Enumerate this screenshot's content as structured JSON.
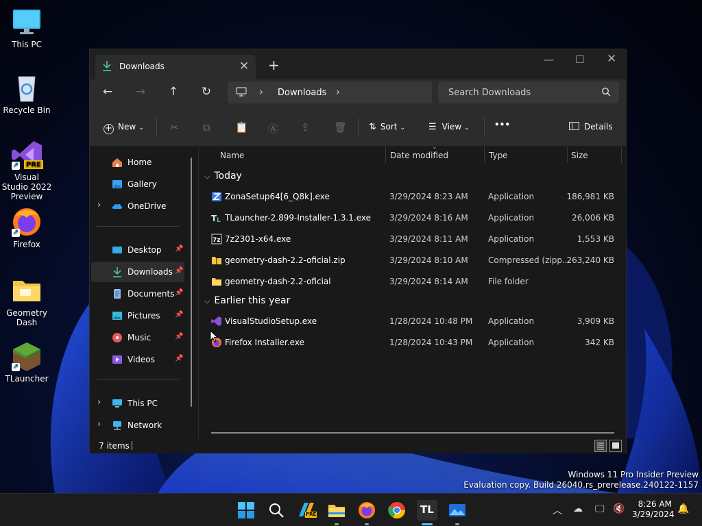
{
  "desktop": {
    "icons": [
      {
        "label": "This PC"
      },
      {
        "label": "Recycle Bin"
      },
      {
        "label": "Visual Studio 2022 Preview",
        "badge": "PRE"
      },
      {
        "label": "Firefox"
      },
      {
        "label": "Geometry Dash"
      },
      {
        "label": "TLauncher"
      }
    ]
  },
  "window": {
    "tab_title": "Downloads",
    "address": {
      "crumb": "Downloads"
    },
    "search": {
      "placeholder": "Search Downloads"
    },
    "commands": {
      "new": "New",
      "sort": "Sort",
      "view": "View",
      "more": "•••",
      "details": "Details"
    },
    "nav": [
      {
        "label": "Home"
      },
      {
        "label": "Gallery"
      },
      {
        "label": "OneDrive"
      },
      {
        "label": "Desktop"
      },
      {
        "label": "Downloads"
      },
      {
        "label": "Documents"
      },
      {
        "label": "Pictures"
      },
      {
        "label": "Music"
      },
      {
        "label": "Videos"
      },
      {
        "label": "This PC"
      },
      {
        "label": "Network"
      }
    ],
    "columns": {
      "name": "Name",
      "date": "Date modified",
      "type": "Type",
      "size": "Size"
    },
    "groups": [
      {
        "label": "Today",
        "files": [
          {
            "name": "ZonaSetup64[6_Q8k].exe",
            "date": "3/29/2024 8:23 AM",
            "type": "Application",
            "size": "186,981 KB"
          },
          {
            "name": "TLauncher-2.899-Installer-1.3.1.exe",
            "date": "3/29/2024 8:16 AM",
            "type": "Application",
            "size": "26,006 KB"
          },
          {
            "name": "7z2301-x64.exe",
            "date": "3/29/2024 8:11 AM",
            "type": "Application",
            "size": "1,553 KB"
          },
          {
            "name": "geometry-dash-2.2-oficial.zip",
            "date": "3/29/2024 8:10 AM",
            "type": "Compressed (zipp...",
            "size": "263,240 KB"
          },
          {
            "name": "geometry-dash-2.2-oficial",
            "date": "3/29/2024 8:14 AM",
            "type": "File folder",
            "size": ""
          }
        ]
      },
      {
        "label": "Earlier this year",
        "files": [
          {
            "name": "VisualStudioSetup.exe",
            "date": "1/28/2024 10:48 PM",
            "type": "Application",
            "size": "3,909 KB"
          },
          {
            "name": "Firefox Installer.exe",
            "date": "1/28/2024 10:43 PM",
            "type": "Application",
            "size": "342 KB"
          }
        ]
      }
    ],
    "status": {
      "count": "7 items"
    }
  },
  "watermark": {
    "line1": "Windows 11 Pro Insider Preview",
    "line2": "Evaluation copy. Build 26040.rs_prerelease.240122-1157"
  },
  "taskbar": {
    "tl_label": "TL",
    "pre_badge": "PRE",
    "time": "8:26 AM",
    "date": "3/29/2024"
  },
  "colors": {
    "accent": "#4cc2ff",
    "folder": "#f5c542",
    "window_bg": "#191919"
  }
}
